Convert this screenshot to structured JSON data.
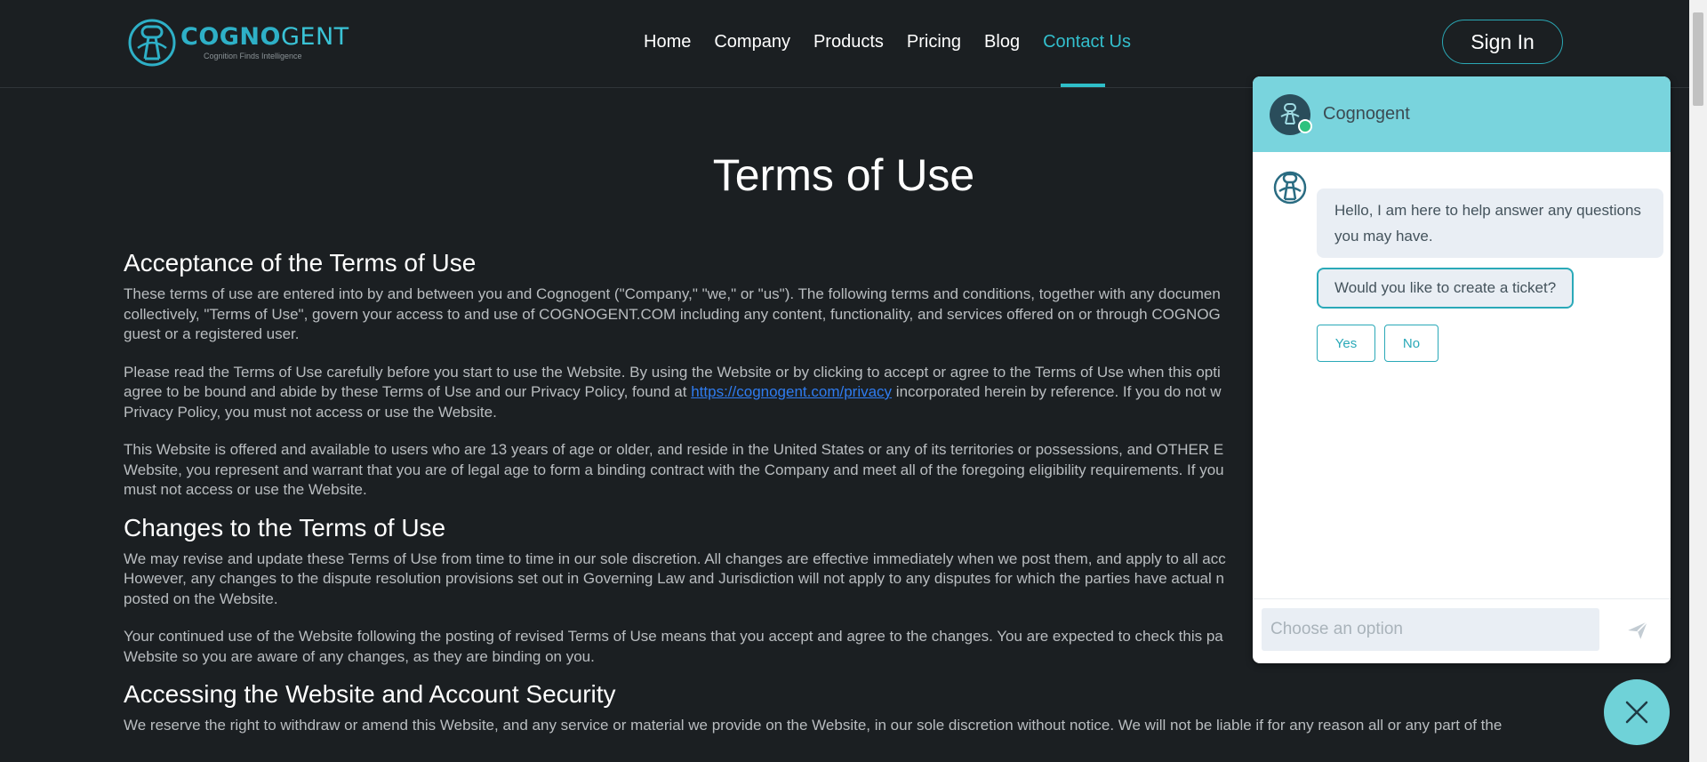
{
  "header": {
    "logo": {
      "brand_bold": "COGNO",
      "brand_light": "GENT",
      "tagline": "Cognition Finds Intelligence"
    },
    "nav": [
      {
        "label": "Home"
      },
      {
        "label": "Company"
      },
      {
        "label": "Products"
      },
      {
        "label": "Pricing"
      },
      {
        "label": "Blog"
      },
      {
        "label": "Contact Us",
        "active": true
      }
    ],
    "signin_label": "Sign In"
  },
  "colors": {
    "accent": "#33bfcd",
    "background": "#1b1f22",
    "chat_header": "#79d4dd"
  },
  "main": {
    "title": "Terms of Use",
    "sections": [
      {
        "heading": "Acceptance of the Terms of Use",
        "paragraphs": [
          {
            "lines": [
              "These terms of use are entered into by and between you and Cognogent (\"Company,\" \"we,\" or \"us\"). The following terms and conditions, together with any documen",
              "collectively, \"Terms of Use\", govern your access to and use of COGNOGENT.COM including any content, functionality, and services offered on or through COGNOG",
              "guest or a registered user."
            ]
          },
          {
            "line1": "Please read the Terms of Use carefully before you start to use the Website. By using the Website or by clicking to accept or agree to the Terms of Use when this opti",
            "line2_before": "agree to be bound and abide by these Terms of Use and our Privacy Policy, found at ",
            "link": "https://cognogent.com/privacy",
            "line2_after": " incorporated herein by reference. If you do not w",
            "line3": "Privacy Policy, you must not access or use the Website."
          },
          {
            "lines": [
              "This Website is offered and available to users who are 13 years of age or older, and reside in the United States or any of its territories or possessions, and OTHER E",
              "Website, you represent and warrant that you are of legal age to form a binding contract with the Company and meet all of the foregoing eligibility requirements. If you",
              "must not access or use the Website."
            ]
          }
        ]
      },
      {
        "heading": "Changes to the Terms of Use",
        "paragraphs": [
          {
            "lines": [
              "We may revise and update these Terms of Use from time to time in our sole discretion. All changes are effective immediately when we post them, and apply to all acc",
              "However, any changes to the dispute resolution provisions set out in Governing Law and Jurisdiction will not apply to any disputes for which the parties have actual n",
              "posted on the Website."
            ]
          },
          {
            "lines": [
              "Your continued use of the Website following the posting of revised Terms of Use means that you accept and agree to the changes. You are expected to check this pa",
              "Website so you are aware of any changes, as they are binding on you."
            ]
          }
        ]
      },
      {
        "heading": "Accessing the Website and Account Security",
        "paragraphs": [
          {
            "lines": [
              "We reserve the right to withdraw or amend this Website, and any service or material we provide on the Website, in our sole discretion without notice. We will not be liable if for any reason all or any part of the"
            ]
          }
        ]
      }
    ]
  },
  "chat": {
    "bot_name": "Cognogent",
    "status": "online",
    "messages": [
      "Hello, I am here to help answer any questions you may have.",
      "Would you like to create a ticket?"
    ],
    "options": [
      "Yes",
      "No"
    ],
    "input_placeholder": "Choose an option"
  }
}
